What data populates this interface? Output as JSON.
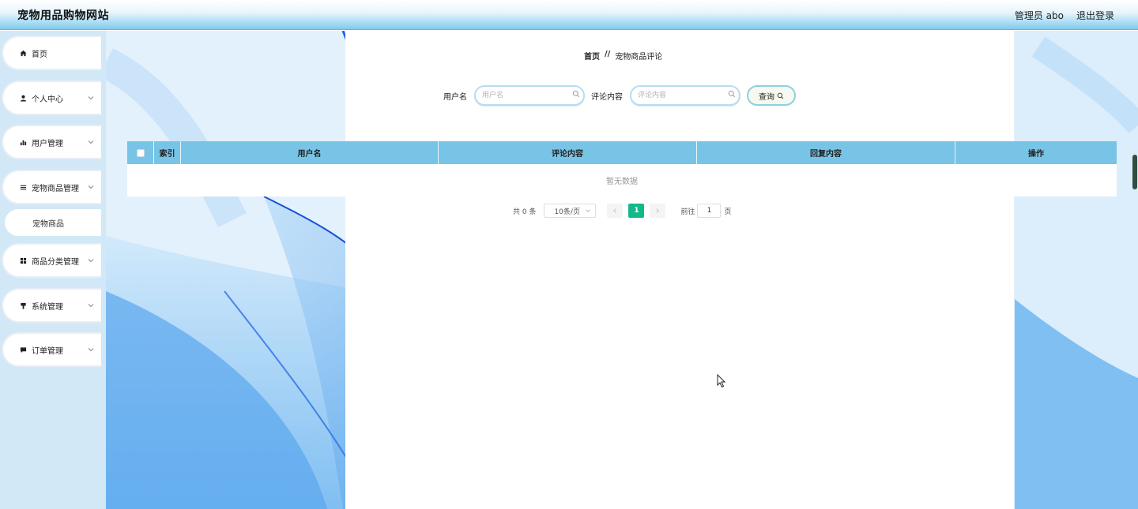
{
  "header": {
    "site_title": "宠物用品购物网站",
    "user_label": "管理员 abo",
    "logout_label": "退出登录"
  },
  "sidebar": {
    "items": [
      {
        "label": "首页",
        "icon": "home-icon",
        "expandable": false
      },
      {
        "label": "个人中心",
        "icon": "user-icon",
        "expandable": true
      },
      {
        "label": "用户管理",
        "icon": "bar-chart-icon",
        "expandable": true
      },
      {
        "label": "宠物商品管理",
        "icon": "list-icon",
        "expandable": true
      },
      {
        "label": "商品分类管理",
        "icon": "grid-icon",
        "expandable": true
      },
      {
        "label": "系统管理",
        "icon": "pin-icon",
        "expandable": true
      },
      {
        "label": "订单管理",
        "icon": "message-icon",
        "expandable": true
      }
    ],
    "sub_items": [
      {
        "label": "宠物商品"
      }
    ]
  },
  "breadcrumb": {
    "home": "首页",
    "separator": "//",
    "current": "宠物商品评论"
  },
  "search": {
    "username_label": "用户名",
    "username_placeholder": "用户名",
    "username_value": "",
    "comment_label": "评论内容",
    "comment_placeholder": "评论内容",
    "comment_value": "",
    "query_label": "查询"
  },
  "table": {
    "columns": [
      "索引",
      "用户名",
      "评论内容",
      "回复内容",
      "操作"
    ],
    "rows": [],
    "empty_text": "暂无数据"
  },
  "pagination": {
    "total_text": "共 0 条",
    "page_size": "10条/页",
    "current_page": "1",
    "goto_label": "前往",
    "goto_value": "1",
    "page_suffix": "页"
  },
  "colors": {
    "header_accent": "#7fcbee",
    "table_header": "#78c4e6",
    "active_page": "#14b88a",
    "sidebar_bg": "#d2e8f6"
  }
}
